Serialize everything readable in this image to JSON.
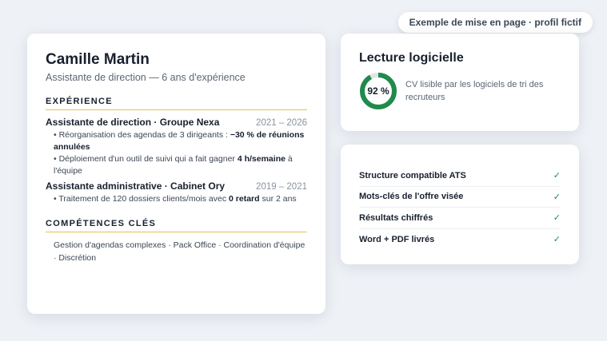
{
  "badge": "Exemple de mise en page · profil fictif",
  "resume": {
    "name": "Camille Martin",
    "subtitle": "Assistante de direction — 6 ans d'expérience",
    "experience_title": "EXPÉRIENCE",
    "jobs": [
      {
        "title": "Assistante de direction · Groupe Nexa",
        "dates": "2021 – 2026",
        "bullets": [
          {
            "before": "Réorganisation des agendas de 3 dirigeants : ",
            "bold": "−30 % de réunions annulées",
            "after": ""
          },
          {
            "before": "Déploiement d'un outil de suivi qui a fait gagner ",
            "bold": "4 h/semaine",
            "after": " à l'équipe"
          }
        ]
      },
      {
        "title": "Assistante administrative · Cabinet Ory",
        "dates": "2019 – 2021",
        "bullets": [
          {
            "before": "Traitement de 120 dossiers clients/mois avec ",
            "bold": "0 retard",
            "after": " sur 2 ans"
          }
        ]
      }
    ],
    "skills_title": "COMPÉTENCES CLÉS",
    "skills": "Gestion d'agendas complexes · Pack Office · Coordination d'équipe · Discrétion"
  },
  "ats": {
    "title": "Lecture logicielle",
    "score_label": "92 %",
    "score_fraction": 0.92,
    "description": "CV lisible par les logiciels de tri des recruteurs",
    "ring_color": "#1f8a4c",
    "ring_track_color": "#dfe6e1"
  },
  "checklist": [
    {
      "label": "Structure compatible ATS",
      "mark": "✓"
    },
    {
      "label": "Mots-clés de l'offre visée",
      "mark": "✓"
    },
    {
      "label": "Résultats chiffrés",
      "mark": "✓"
    },
    {
      "label": "Word + PDF livrés",
      "mark": "✓"
    }
  ]
}
